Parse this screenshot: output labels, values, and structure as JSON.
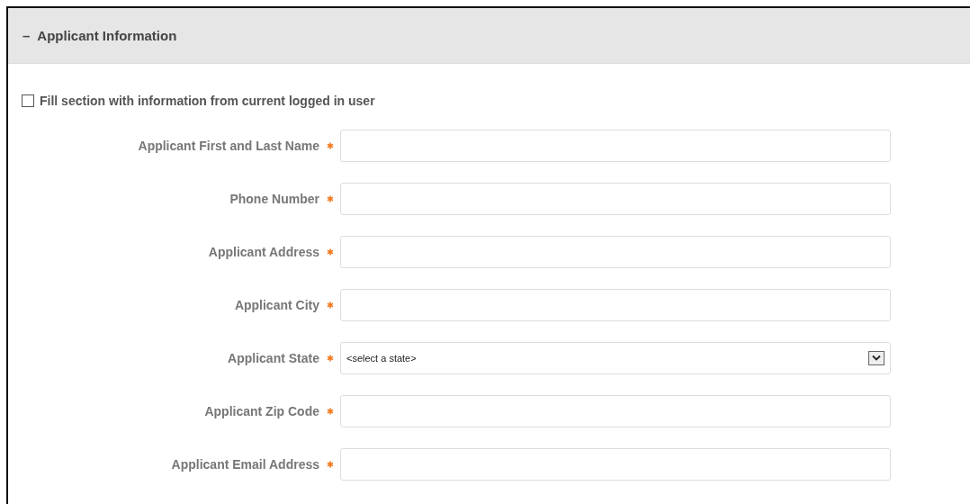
{
  "section": {
    "title": "Applicant Information",
    "expanded": true,
    "toggle": "–"
  },
  "prefill": {
    "label": "Fill section with information from current logged in user",
    "checked": false
  },
  "fields": [
    {
      "label": "Applicant First and Last Name",
      "required": true,
      "kind": "text"
    },
    {
      "label": "Phone Number",
      "required": true,
      "kind": "text"
    },
    {
      "label": "Applicant Address",
      "required": true,
      "kind": "text"
    },
    {
      "label": "Applicant City",
      "required": true,
      "kind": "text"
    },
    {
      "label": "Applicant State",
      "required": true,
      "kind": "select",
      "value": "<select a state>"
    },
    {
      "label": "Applicant Zip Code",
      "required": true,
      "kind": "text"
    },
    {
      "label": "Applicant Email Address",
      "required": true,
      "kind": "text"
    }
  ]
}
